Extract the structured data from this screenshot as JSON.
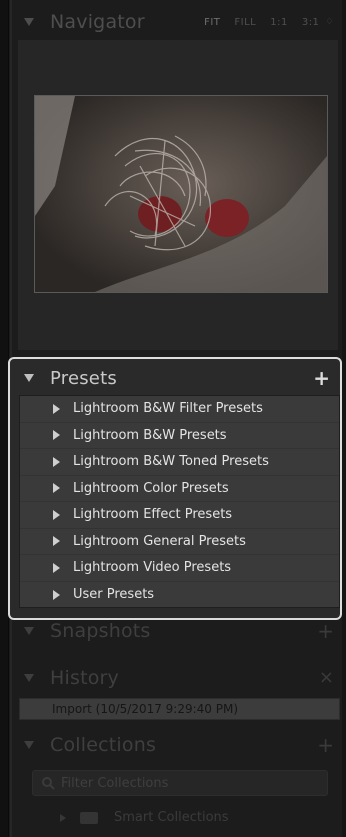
{
  "navigator": {
    "title": "Navigator",
    "zoom_options": [
      "FIT",
      "FILL",
      "1:1",
      "3:1"
    ],
    "zoom_dropdown_glyph": "♢"
  },
  "presets": {
    "title": "Presets",
    "add_glyph": "+",
    "items": [
      "Lightroom B&W Filter Presets",
      "Lightroom B&W Presets",
      "Lightroom B&W Toned Presets",
      "Lightroom Color Presets",
      "Lightroom Effect Presets",
      "Lightroom General Presets",
      "Lightroom Video Presets",
      "User Presets"
    ]
  },
  "snapshots": {
    "title": "Snapshots",
    "add_glyph": "+"
  },
  "history": {
    "title": "History",
    "clear_glyph": "×",
    "entries": [
      "Import (10/5/2017 9:29:40 PM)"
    ]
  },
  "collections": {
    "title": "Collections",
    "add_glyph": "+",
    "filter_placeholder": "Filter Collections",
    "smart_collections_label": "Smart Collections"
  },
  "colors": {
    "panel_bg": "#1c1c1c",
    "list_bg": "#3a3a3a",
    "highlight_border": "#dcdcdc",
    "text_active": "#e4e4e4",
    "text_dim": "#3f3f3f"
  }
}
